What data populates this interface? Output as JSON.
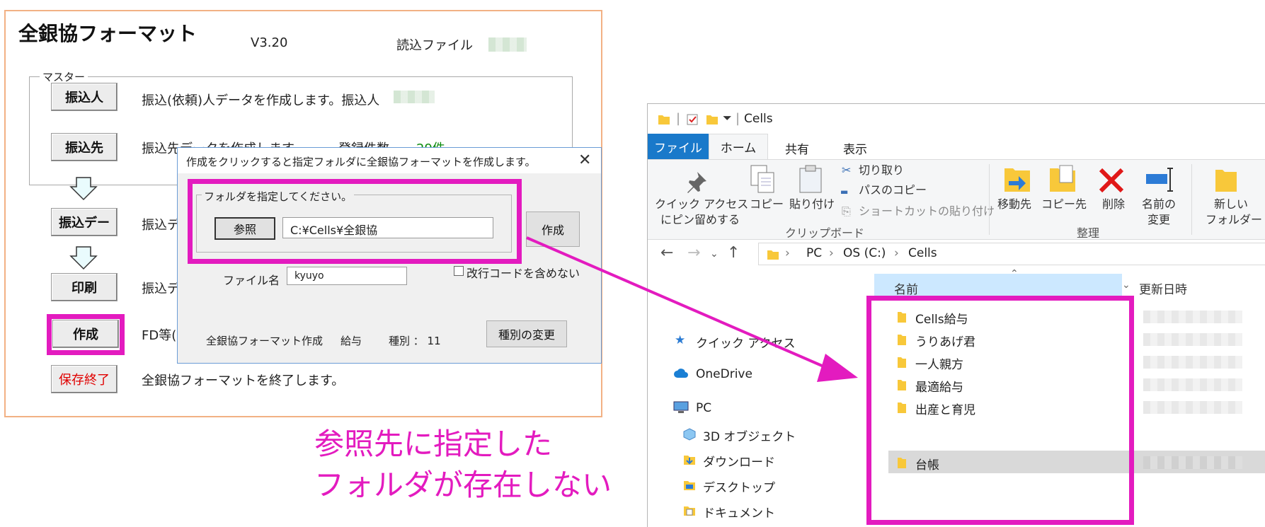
{
  "main": {
    "title": "全銀協フォーマット",
    "version": "V3.20",
    "read_file_label": "読込ファイル",
    "master_label": "マスター",
    "buttons": {
      "payer": "振込人",
      "payee": "振込先",
      "transfer_data": "振込デー",
      "print": "印刷",
      "create": "作成",
      "save_exit": "保存終了"
    },
    "desc": {
      "payer": "振込(依頼)人データを作成します。振込人",
      "payee": "振込先データを作成します。",
      "payee_count_label": "登録件数",
      "payee_count": "29件",
      "transfer_data": "振込デ",
      "print": "振込デ",
      "create": "FD等(",
      "save_exit": "全銀協フォーマットを終了します。"
    }
  },
  "dialog": {
    "title": "作成をクリックすると指定フォルダに全銀協フォーマットを作成します。",
    "close": "✕",
    "folder_group_label": "フォルダを指定してください。",
    "browse_label": "参照",
    "folder_path": "C:¥Cells¥全銀協",
    "create_label": "作成",
    "file_name_label": "ファイル名",
    "file_name_value": "kyuyo",
    "no_newline_label": "改行コードを含めない",
    "status_title": "全銀協フォーマット作成",
    "status_type": "給与",
    "status_kind": "種別 ： 11",
    "change_kind_label": "種別の変更"
  },
  "caption": {
    "line1": "参照先に指定した",
    "line2": "フォルダが存在しない"
  },
  "explorer": {
    "window_title": "Cells",
    "tabs": [
      "ファイル",
      "ホーム",
      "共有",
      "表示"
    ],
    "ribbon": {
      "pin_label_1": "クイック アクセス",
      "pin_label_2": "にピン留めする",
      "copy_label": "コピー",
      "paste_label": "貼り付け",
      "cut_label": "切り取り",
      "copy_path_label": "パスのコピー",
      "paste_shortcut_label": "ショートカットの貼り付け",
      "clipboard_group": "クリップボード",
      "move_to_label": "移動先",
      "copy_to_label": "コピー先",
      "delete_label": "削除",
      "rename_label_1": "名前の",
      "rename_label_2": "変更",
      "organize_group": "整理",
      "new_folder_label_1": "新しい",
      "new_folder_label_2": "フォルダー"
    },
    "address": [
      "PC",
      "OS (C:)",
      "Cells"
    ],
    "nav": {
      "quick_access": "クイック アクセス",
      "onedrive": "OneDrive",
      "pc": "PC",
      "objects3d": "3D オブジェクト",
      "downloads": "ダウンロード",
      "desktop": "デスクトップ",
      "documents": "ドキュメント"
    },
    "columns": {
      "name": "名前",
      "modified": "更新日時"
    },
    "files": [
      "Cells給与",
      "うりあげ君",
      "一人親方",
      "最適給与",
      "出産と育児",
      "台帳"
    ],
    "colors": {
      "accent": "#1979ca",
      "highlight": "#e31bbf",
      "folder": "#f8c83a"
    }
  }
}
